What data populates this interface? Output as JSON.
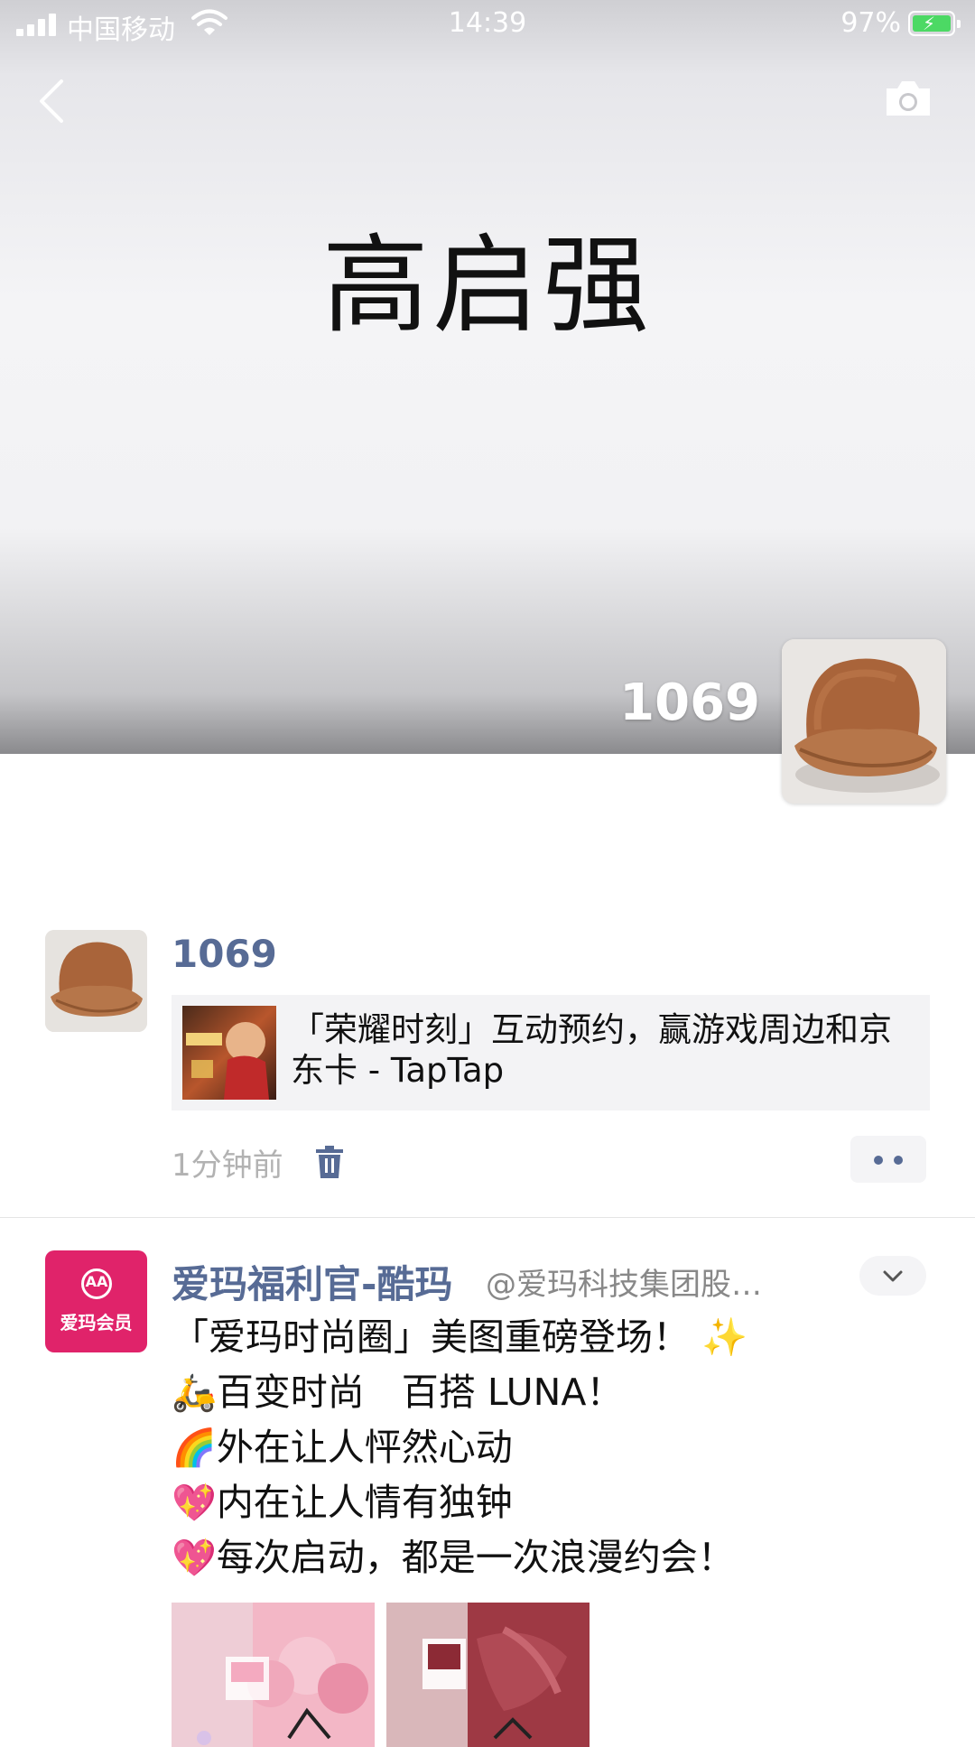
{
  "status_bar": {
    "carrier": "中国移动",
    "time": "14:39",
    "battery": "97%"
  },
  "cover": {
    "title": "高启强",
    "username": "1069"
  },
  "posts": [
    {
      "author": "1069",
      "link_title": "「荣耀时刻」互动预约，赢游戏周边和京东卡 - TapTap",
      "time": "1分钟前"
    },
    {
      "author": "爱玛福利官-酷玛",
      "source": "@爱玛科技集团股…",
      "avatar_text": "爱玛会员",
      "lines": [
        {
          "emoji": "",
          "text": "「爱玛时尚圈」美图重磅登场！ ✨"
        },
        {
          "emoji": "🛵",
          "text": "百变时尚　百搭 LUNA！"
        },
        {
          "emoji": "🌈",
          "text": "外在让人怦然心动"
        },
        {
          "emoji": "💖",
          "text": "内在让人情有独钟"
        },
        {
          "emoji": "💖",
          "text": "每次启动，都是一次浪漫约会！"
        }
      ]
    }
  ],
  "colors": {
    "link_blue": "#576b95",
    "brand_pink": "#e0236a",
    "battery_green": "#4cd964"
  }
}
